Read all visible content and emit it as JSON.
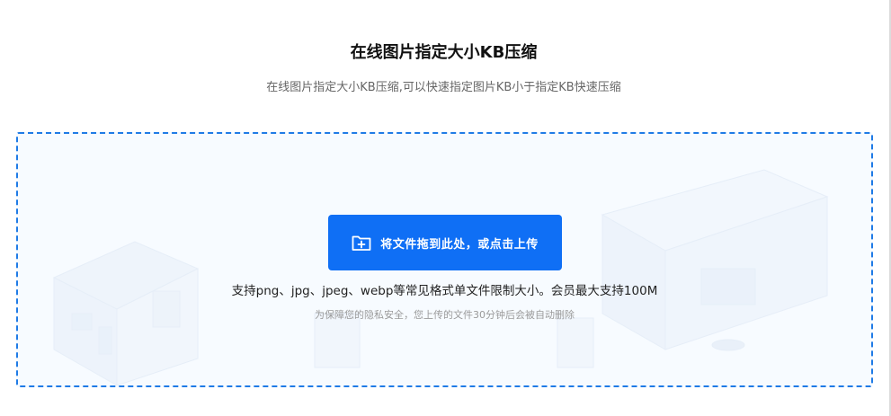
{
  "header": {
    "title": "在线图片指定大小KB压缩",
    "subtitle": "在线图片指定大小KB压缩,可以快速指定图片KB小于指定KB快速压缩"
  },
  "upload": {
    "button_label": "将文件拖到此处，或点击上传",
    "button_icon": "folder-plus-icon",
    "support_text": "支持png、jpg、jpeg、webp等常见格式单文件限制大小。会员最大支持100M",
    "privacy_text": "为保障您的隐私安全，您上传的文件30分钟后会被自动删除"
  },
  "colors": {
    "accent": "#0f6ff5",
    "dropzone_border": "#1f7be6",
    "dropzone_bg": "#f7fbff"
  }
}
